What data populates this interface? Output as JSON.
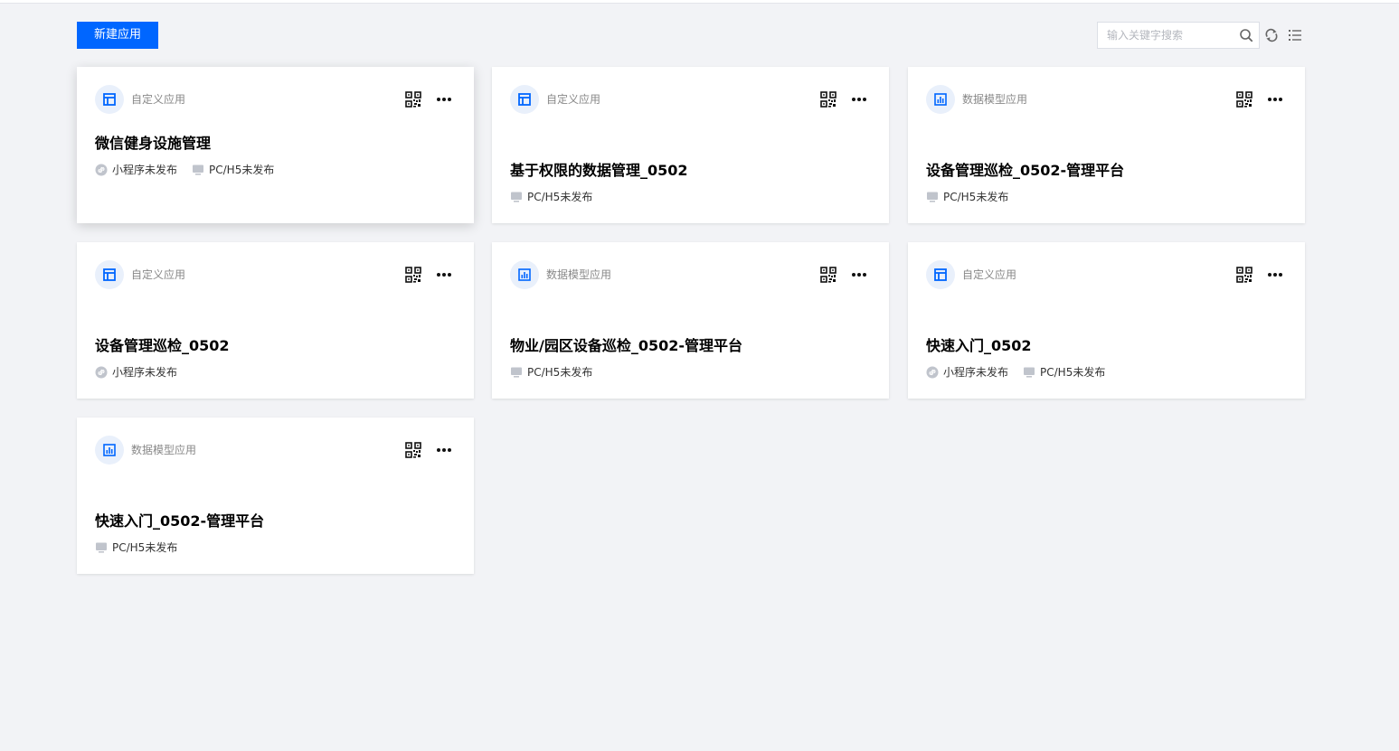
{
  "toolbar": {
    "new_app_label": "新建应用",
    "search_placeholder": "输入关键字搜索",
    "search_value": ""
  },
  "colors": {
    "accent": "#0066ff",
    "background": "#f2f3f6",
    "badge_bg": "#e9f0fb",
    "status_icon": "#c0c4cc"
  },
  "icons": {
    "custom_app": "layout-icon",
    "data_model_app": "bar-chart-icon",
    "qr": "qr-code-icon",
    "more": "more-dots-icon",
    "mini_program": "mini-program-icon",
    "pc": "monitor-icon"
  },
  "apps": [
    {
      "type": "custom",
      "type_label": "自定义应用",
      "title": "微信健身设施管理",
      "mini_status": "小程序未发布",
      "pc_status": "PC/H5未发布"
    },
    {
      "type": "custom",
      "type_label": "自定义应用",
      "title": "基于权限的数据管理_0502",
      "mini_status": "",
      "pc_status": "PC/H5未发布"
    },
    {
      "type": "data_model",
      "type_label": "数据模型应用",
      "title": "设备管理巡检_0502-管理平台",
      "mini_status": "",
      "pc_status": "PC/H5未发布"
    },
    {
      "type": "custom",
      "type_label": "自定义应用",
      "title": "设备管理巡检_0502",
      "mini_status": "小程序未发布",
      "pc_status": ""
    },
    {
      "type": "data_model",
      "type_label": "数据模型应用",
      "title": "物业/园区设备巡检_0502-管理平台",
      "mini_status": "",
      "pc_status": "PC/H5未发布"
    },
    {
      "type": "custom",
      "type_label": "自定义应用",
      "title": "快速入门_0502",
      "mini_status": "小程序未发布",
      "pc_status": "PC/H5未发布"
    },
    {
      "type": "data_model",
      "type_label": "数据模型应用",
      "title": "快速入门_0502-管理平台",
      "mini_status": "",
      "pc_status": "PC/H5未发布"
    }
  ]
}
